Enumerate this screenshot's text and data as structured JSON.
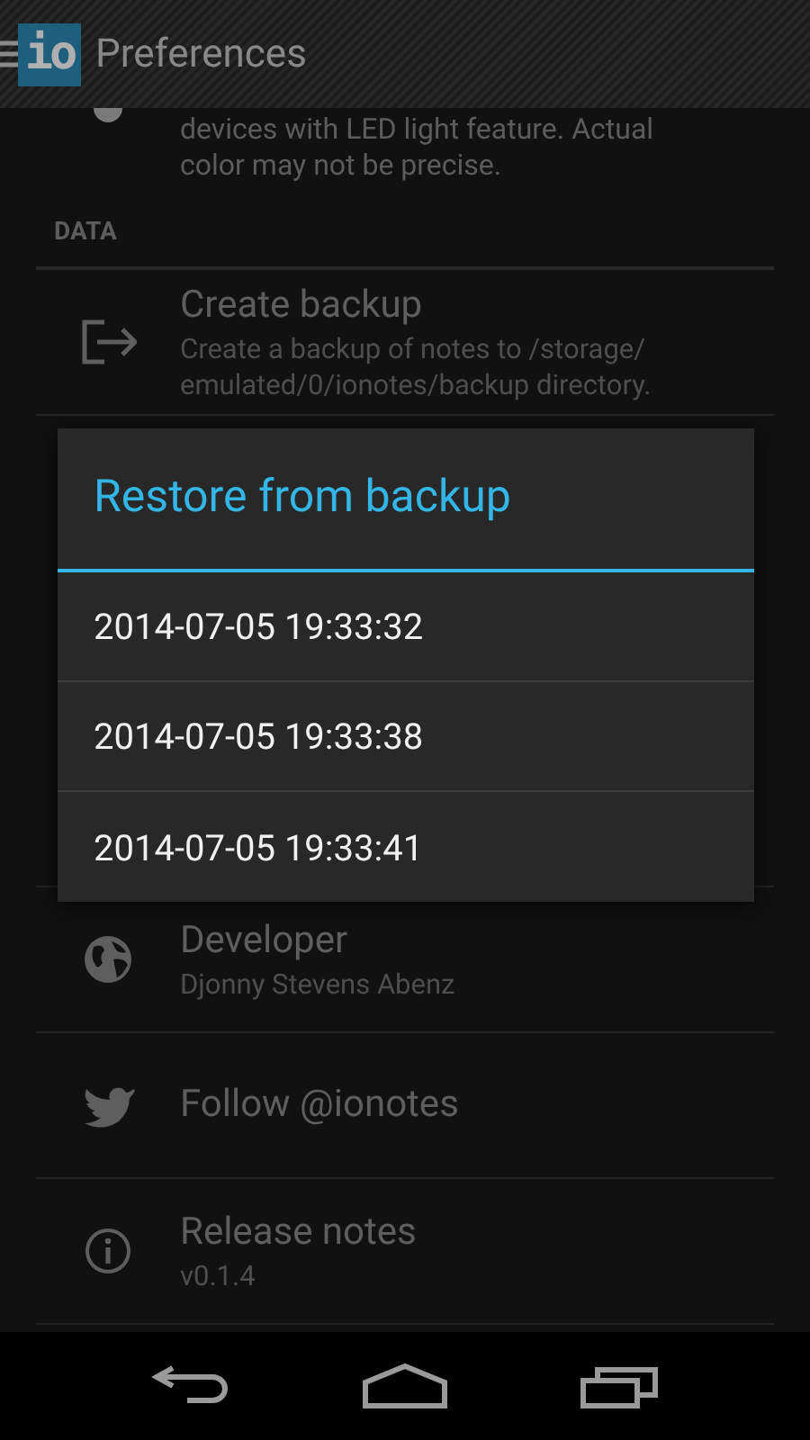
{
  "action_bar": {
    "logo": "io",
    "title": "Preferences"
  },
  "list": [
    {
      "kind": "partial",
      "summary": "devices with LED light feature. Actual color may not be precise."
    },
    {
      "kind": "header",
      "title": "DATA"
    },
    {
      "kind": "item",
      "title": "Create backup",
      "summary": "Create a backup of notes to /storage/ emulated/0/ionotes/backup directory."
    },
    {
      "kind": "hidden"
    },
    {
      "kind": "item",
      "title": "Developer",
      "summary": "Djonny Stevens Abenz"
    },
    {
      "kind": "item",
      "title": "Follow @ionotes"
    },
    {
      "kind": "item",
      "title": "Release notes",
      "summary": "v0.1.4"
    }
  ],
  "dialog": {
    "title": "Restore from backup",
    "items": [
      "2014-07-05 19:33:32",
      "2014-07-05 19:33:38",
      "2014-07-05 19:33:41"
    ]
  }
}
